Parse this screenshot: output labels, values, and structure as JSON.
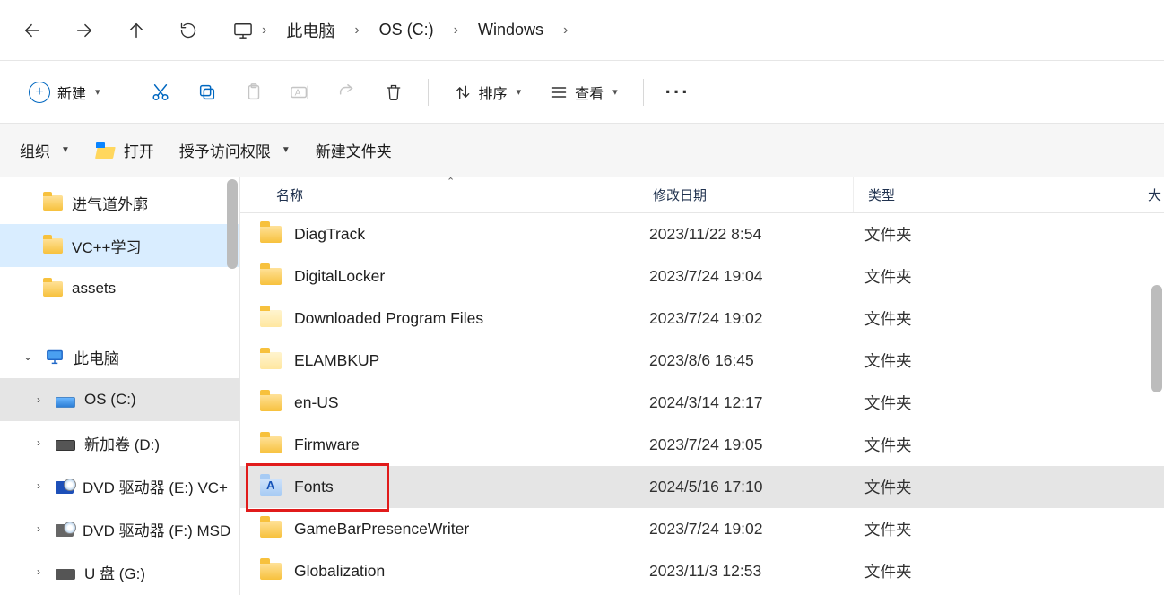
{
  "breadcrumb": [
    "此电脑",
    "OS (C:)",
    "Windows"
  ],
  "toolbar": {
    "new_label": "新建",
    "sort_label": "排序",
    "view_label": "查看"
  },
  "cmdbar": {
    "organize": "组织",
    "open": "打开",
    "grant": "授予访问权限",
    "new_folder": "新建文件夹"
  },
  "columns": {
    "name": "名称",
    "date": "修改日期",
    "type": "类型",
    "extra": "大"
  },
  "sidebar_top": [
    {
      "label": "进气道外廓"
    },
    {
      "label": "VC++学习",
      "selected": true
    },
    {
      "label": "assets"
    }
  ],
  "sidebar_pc": "此电脑",
  "sidebar_drives": [
    {
      "label": "OS (C:)",
      "kind": "os",
      "selected": true,
      "expanded": false
    },
    {
      "label": "新加卷 (D:)",
      "kind": "hdd",
      "expanded": false
    },
    {
      "label": "DVD 驱动器 (E:) VC+",
      "kind": "dvd-blue",
      "expanded": false
    },
    {
      "label": "DVD 驱动器 (F:) MSD",
      "kind": "dvd-grey",
      "expanded": false
    },
    {
      "label": "U 盘 (G:)",
      "kind": "usb",
      "expanded": false
    }
  ],
  "rows": [
    {
      "name": "DiagTrack",
      "date": "2023/11/22 8:54",
      "type": "文件夹",
      "icon": "folder"
    },
    {
      "name": "DigitalLocker",
      "date": "2023/7/24 19:04",
      "type": "文件夹",
      "icon": "folder"
    },
    {
      "name": "Downloaded Program Files",
      "date": "2023/7/24 19:02",
      "type": "文件夹",
      "icon": "folder-pale"
    },
    {
      "name": "ELAMBKUP",
      "date": "2023/8/6 16:45",
      "type": "文件夹",
      "icon": "folder-pale"
    },
    {
      "name": "en-US",
      "date": "2024/3/14 12:17",
      "type": "文件夹",
      "icon": "folder"
    },
    {
      "name": "Firmware",
      "date": "2023/7/24 19:05",
      "type": "文件夹",
      "icon": "folder"
    },
    {
      "name": "Fonts",
      "date": "2024/5/16 17:10",
      "type": "文件夹",
      "icon": "fonts",
      "selected": true
    },
    {
      "name": "GameBarPresenceWriter",
      "date": "2023/7/24 19:02",
      "type": "文件夹",
      "icon": "folder"
    },
    {
      "name": "Globalization",
      "date": "2023/11/3 12:53",
      "type": "文件夹",
      "icon": "folder"
    }
  ]
}
